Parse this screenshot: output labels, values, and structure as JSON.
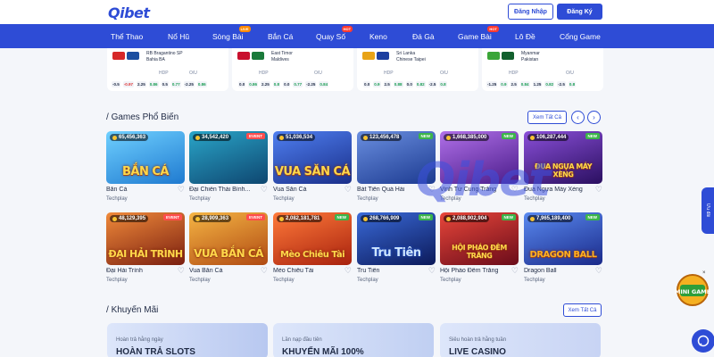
{
  "header": {
    "logo": "Qibet",
    "login_label": "Đăng Nhập",
    "register_label": "Đăng Ký"
  },
  "nav": {
    "items": [
      {
        "label": "Thể Thao",
        "badge": ""
      },
      {
        "label": "Nổ Hũ",
        "badge": ""
      },
      {
        "label": "Sòng Bài",
        "badge": "LIVE"
      },
      {
        "label": "Bắn Cá",
        "badge": ""
      },
      {
        "label": "Quay Số",
        "badge": "HOT"
      },
      {
        "label": "Keno",
        "badge": ""
      },
      {
        "label": "Đá Gà",
        "badge": ""
      },
      {
        "label": "Game Bài",
        "badge": "HOT"
      },
      {
        "label": "Lô Đề",
        "badge": ""
      },
      {
        "label": "Cổng Game",
        "badge": ""
      }
    ]
  },
  "matches": [
    {
      "team1": "RB Bragantino SP",
      "team2": "Bahia BA",
      "hdp_label": "HDP",
      "ou_label": "O/U",
      "odds": [
        "-0.5",
        "-0.97",
        "2.25",
        "0.86",
        "0.5",
        "0.77",
        "-2.25",
        "0.86"
      ]
    },
    {
      "team1": "East Timor",
      "team2": "Maldives",
      "hdp_label": "HDP",
      "ou_label": "O/U",
      "odds": [
        "0.0",
        "0.86",
        "2.25",
        "0.8",
        "0.0",
        "0.77",
        "-2.25",
        "0.84"
      ]
    },
    {
      "team1": "Sri Lanka",
      "team2": "Chinese Taipei",
      "hdp_label": "HDP",
      "ou_label": "O/U",
      "odds": [
        "0.0",
        "0.9",
        "2.5",
        "0.88",
        "0.0",
        "0.82",
        "-2.5",
        "0.8"
      ]
    },
    {
      "team1": "Myanmar",
      "team2": "Pakistan",
      "hdp_label": "HDP",
      "ou_label": "O/U",
      "odds": [
        "-1.25",
        "0.9",
        "2.5",
        "0.84",
        "1.25",
        "0.82",
        "-2.5",
        "0.8"
      ]
    }
  ],
  "games_section": {
    "title": "Games Phổ Biến",
    "see_all_label": "Xem Tất Cả",
    "prev_icon": "chevron-left-icon",
    "next_icon": "chevron-right-icon",
    "games": [
      {
        "count": "65,456,363",
        "tag": "",
        "art": "BẮN CÁ",
        "name": "Bắn Cá",
        "provider": "Techplay",
        "bg": "#3aa8e8"
      },
      {
        "count": "34,542,420",
        "tag": "EVENT",
        "art": "",
        "name": "Đại Chiến Thái Bình...",
        "provider": "Techplay",
        "bg": "#1a6fa8"
      },
      {
        "count": "51,036,534",
        "tag": "",
        "art": "VUA SĂN CÁ",
        "name": "Vua Săn Cá",
        "provider": "Techplay",
        "bg": "#2e57c7"
      },
      {
        "count": "123,456,478",
        "tag": "NEW",
        "art": "",
        "name": "Bát Tiên Quá Hải",
        "provider": "Techplay",
        "bg": "#2a5fa8"
      },
      {
        "count": "1,668,385,000",
        "tag": "NEW",
        "art": "",
        "name": "Vinh Tử Cung Trăng",
        "provider": "Techplay",
        "bg": "#8a3fb8"
      },
      {
        "count": "106,287,444",
        "tag": "NEW",
        "art": "ĐUA NGỰA MÁY XÈNG",
        "name": "Đua Ngựa Máy Xèng",
        "provider": "Techplay",
        "bg": "#6a2fa8"
      },
      {
        "count": "48,129,395",
        "tag": "EVENT",
        "art": "ĐẠI HẢI TRÌNH",
        "name": "Đại Hải Trình",
        "provider": "Techplay",
        "bg": "#c0401a"
      },
      {
        "count": "28,909,363",
        "tag": "EVENT",
        "art": "VUA BẮN CÁ",
        "name": "Vua Bắn Cá",
        "provider": "Techplay",
        "bg": "#d97820"
      },
      {
        "count": "2,082,181,781",
        "tag": "NEW",
        "art": "Mèo Chiêu Tài",
        "name": "Mèo Chiêu Tài",
        "provider": "Techplay",
        "bg": "#e04818"
      },
      {
        "count": "268,766,909",
        "tag": "NEW",
        "art": "Tru Tiên",
        "name": "Tru Tiên",
        "provider": "Techplay",
        "bg": "#1f3a88"
      },
      {
        "count": "2,088,902,904",
        "tag": "NEW",
        "art": "HỘI PHÁO ĐÊM TRĂNG",
        "name": "Hội Pháo Đêm Trăng",
        "provider": "Techplay",
        "bg": "#c02838"
      },
      {
        "count": "7,965,189,400",
        "tag": "NEW",
        "art": "DRAGON BALL",
        "name": "Dragon Ball",
        "provider": "Techplay",
        "bg": "#3a68d8"
      }
    ]
  },
  "promo_section": {
    "title": "Khuyến Mãi",
    "see_all_label": "Xem Tất Cả",
    "cards": [
      {
        "small": "Hoàn trả hằng ngày",
        "big": "HOÀN TRẢ SLOTS"
      },
      {
        "small": "Lần nạp đầu tiên",
        "big": "KHUYẾN MÃI 100%"
      },
      {
        "small": "Siêu hoàn trả hằng tuần",
        "big": "LIVE CASINO"
      }
    ]
  },
  "watermark": "Qibet",
  "widgets": {
    "side_tab": "Ưu đãi",
    "mini_game": "MINI GAME",
    "mini_close": "×",
    "chat_icon": "chat-icon"
  }
}
